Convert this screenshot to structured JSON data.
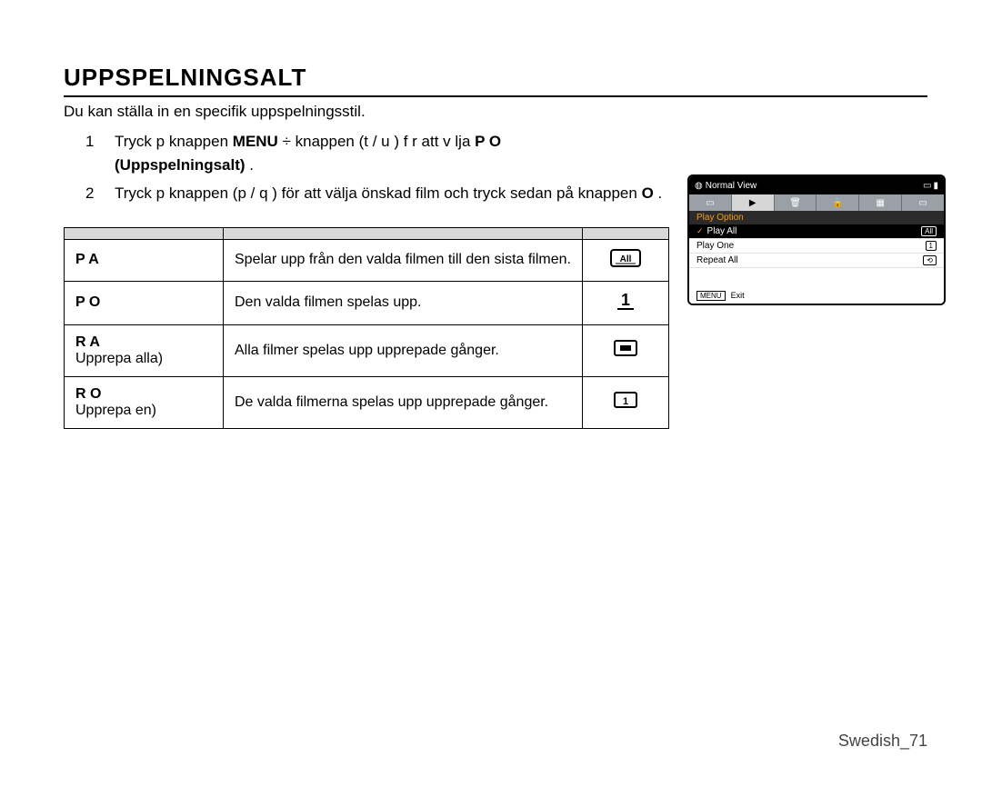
{
  "heading": "UPPSPELNINGSALT",
  "intro": "Du kan ställa in en specifik uppspelningsstil.",
  "steps": [
    {
      "num": "1",
      "text_a": "Tryck p  knappen  ",
      "menu": "MENU",
      "arrow": " ÷ ",
      "text_b": " knappen (t   / u ) f r att v lja   ",
      "opt": "P O ",
      "opt_sv": "(Uppspelningsalt)",
      "period": " ."
    },
    {
      "num": "2",
      "text_a": "Tryck p   ",
      "text_b": " knappen (p   / q ) för att välja önskad film och tryck sedan på knappen ",
      "ok": "O",
      "period": " ."
    }
  ],
  "table": {
    "headers": [
      "",
      "",
      ""
    ],
    "rows": [
      {
        "c1a": "P A ",
        "c1b": "",
        "c2": "Spelar upp från den valda filmen till den sista filmen.",
        "icon": "all"
      },
      {
        "c1a": "P O ",
        "c1b": "",
        "c2": "Den valda filmen spelas upp.",
        "icon": "one"
      },
      {
        "c1a": "R A ",
        "c1b": "Upprepa alla)",
        "c2": "Alla filmer spelas upp upprepade gånger.",
        "icon": "repall"
      },
      {
        "c1a": "R O ",
        "c1b": "Upprepa en)",
        "c2": "De valda filmerna spelas upp upprepade gånger.",
        "icon": "repone"
      }
    ]
  },
  "screen": {
    "title": "Normal View",
    "section": "Play Option",
    "items": [
      {
        "label": "Play All",
        "badge": "All",
        "selected": true
      },
      {
        "label": "Play One",
        "badge": "1",
        "selected": false
      },
      {
        "label": "Repeat All",
        "badge": "⟲",
        "selected": false
      }
    ],
    "foot_menu": "MENU",
    "foot_exit": "Exit"
  },
  "footer": "Swedish_71"
}
